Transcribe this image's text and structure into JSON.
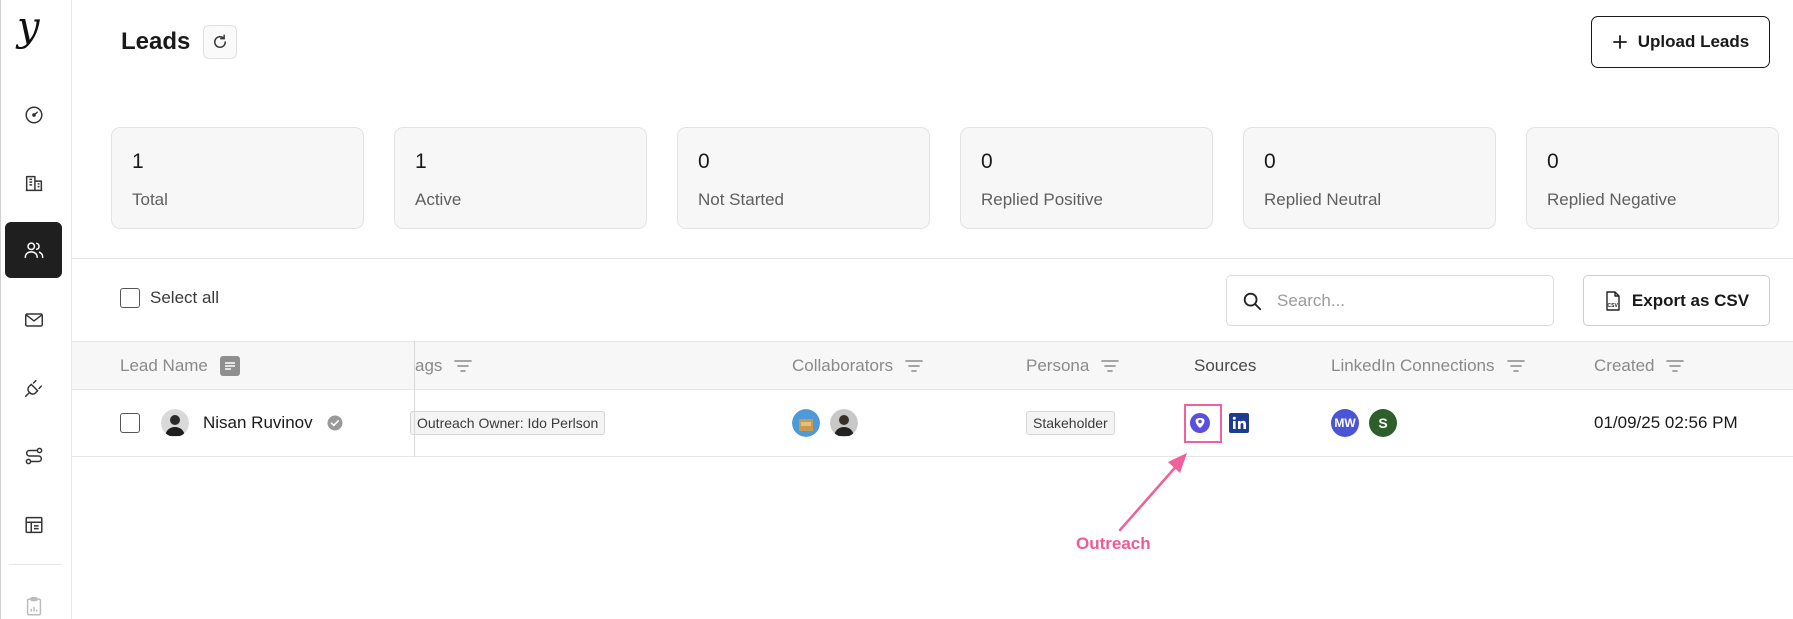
{
  "app": {
    "logo": "y"
  },
  "header": {
    "title": "Leads",
    "upload_label": "Upload Leads"
  },
  "sidebar": {
    "items": [
      {
        "icon": "dashboard-icon"
      },
      {
        "icon": "building-icon"
      },
      {
        "icon": "users-icon",
        "active": true
      },
      {
        "icon": "mail-icon"
      },
      {
        "icon": "plug-icon"
      },
      {
        "icon": "route-icon"
      },
      {
        "icon": "layout-icon"
      },
      {
        "icon": "clipboard-icon"
      }
    ]
  },
  "stats": [
    {
      "value": "1",
      "label": "Total"
    },
    {
      "value": "1",
      "label": "Active"
    },
    {
      "value": "0",
      "label": "Not Started"
    },
    {
      "value": "0",
      "label": "Replied Positive"
    },
    {
      "value": "0",
      "label": "Replied Neutral"
    },
    {
      "value": "0",
      "label": "Replied Negative"
    }
  ],
  "toolbar": {
    "select_all": "Select all",
    "search_placeholder": "Search...",
    "export_label": "Export as CSV"
  },
  "table": {
    "columns": {
      "lead_name": "Lead Name",
      "tags": "ags",
      "collaborators": "Collaborators",
      "persona": "Persona",
      "sources": "Sources",
      "linkedin": "LinkedIn Connections",
      "created": "Created"
    },
    "rows": [
      {
        "name": "Nisan Ruvinov",
        "tag": "Outreach Owner: Ido Perlson",
        "persona": "Stakeholder",
        "linkedin": [
          "MW",
          "S"
        ],
        "created": "01/09/25 02:56 PM"
      }
    ]
  },
  "annotation": {
    "label": "Outreach",
    "color": "#ee5a94"
  },
  "colors": {
    "sidebar_active": "#1f1f1f",
    "outreach": "#5b4fe0",
    "linkedin": "#1d3b8f",
    "mw_avatar": "#4a55d6",
    "s_avatar": "#2e5e2a"
  }
}
